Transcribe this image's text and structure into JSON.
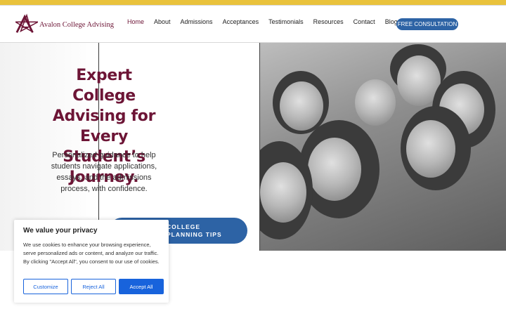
{
  "brand": {
    "name": "Avalon College Advising"
  },
  "nav": {
    "items": [
      "Home",
      "About",
      "Admissions",
      "Acceptances",
      "Testimonials",
      "Resources",
      "Contact",
      "Blog"
    ],
    "active": "Home",
    "cta": "FREE CONSULTATION"
  },
  "hero": {
    "title": "Expert College Advising for Every Student’s Journey.",
    "subtitle": "Personalized guidance to help students navigate applications, essays, and the admissions process, with confidence.",
    "cta": "COLLEGE PLANNING TIPS"
  },
  "cookie": {
    "title": "We value your privacy",
    "text": "We use cookies to enhance your browsing experience, serve personalized ads or content, and analyze our traffic. By clicking \"Accept All\", you consent to our use of cookies.",
    "customize": "Customize",
    "reject": "Reject All",
    "accept": "Accept All"
  },
  "colors": {
    "brand": "#6d1536",
    "accent": "#2d63a5",
    "topbar": "#e9c23c",
    "cookie_button": "#1863dc"
  }
}
